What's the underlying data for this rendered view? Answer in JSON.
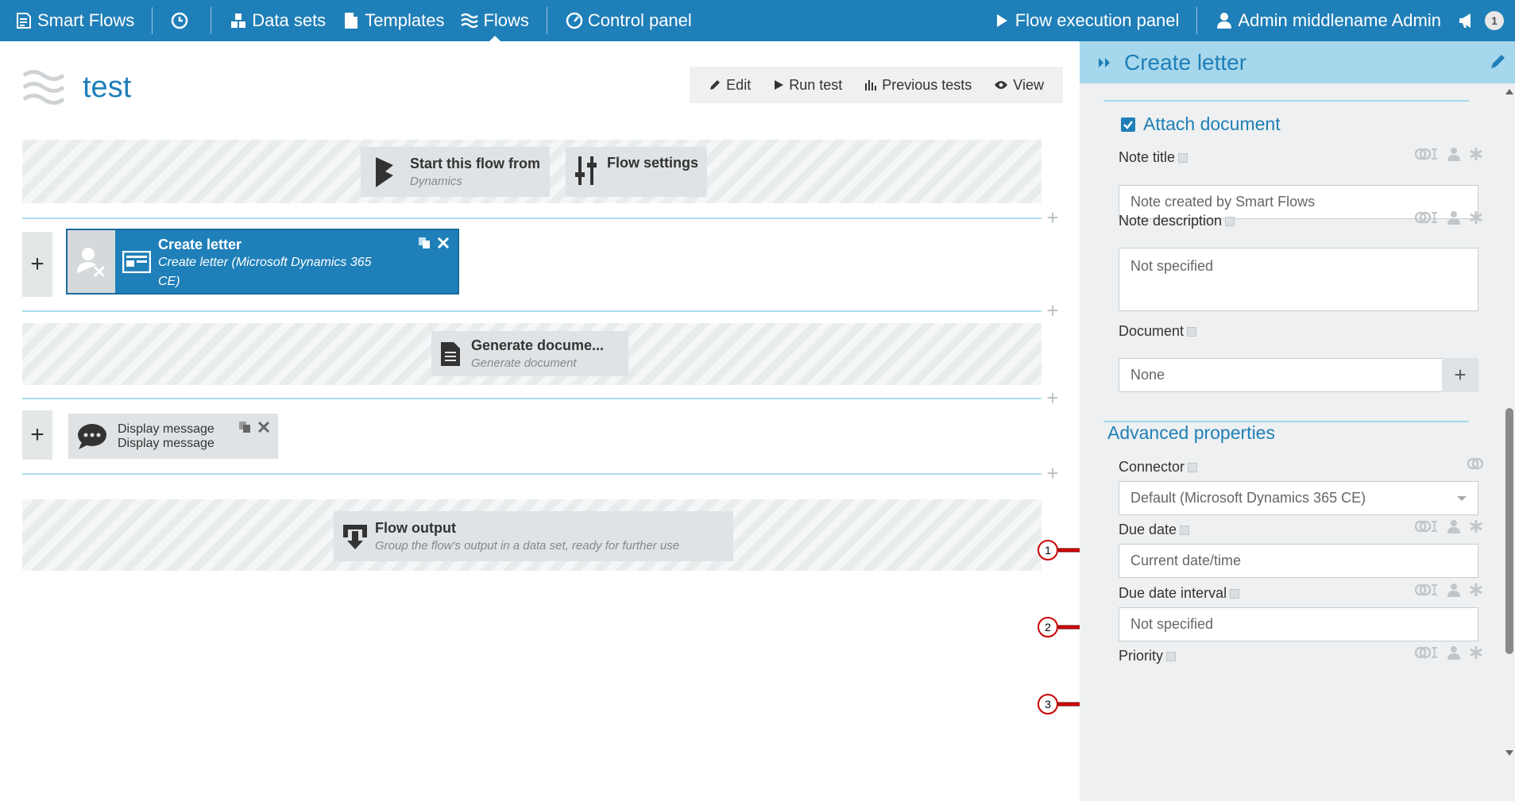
{
  "topbar": {
    "brand": "Smart Flows",
    "nav": {
      "data_sets": "Data sets",
      "templates": "Templates",
      "flows": "Flows",
      "control_panel": "Control panel",
      "flow_execution_panel": "Flow execution panel",
      "user": "Admin middlename Admin",
      "notification_count": "1"
    }
  },
  "flow": {
    "title": "test",
    "toolbar": {
      "edit": "Edit",
      "run_test": "Run test",
      "previous_tests": "Previous tests",
      "view": "View"
    }
  },
  "canvas": {
    "start": {
      "title": "Start this flow from",
      "subtitle": "Dynamics"
    },
    "settings": {
      "title": "Flow settings"
    },
    "create_letter": {
      "title": "Create letter",
      "subtitle": "Create letter (Microsoft Dynamics 365 CE)"
    },
    "generate": {
      "title": "Generate docume...",
      "subtitle": "Generate document"
    },
    "display_message": {
      "title": "Display message",
      "subtitle": "Display message"
    },
    "output": {
      "title": "Flow output",
      "subtitle": "Group the flow's output in a data set, ready for further use"
    }
  },
  "panel": {
    "title": "Create letter",
    "attach_document": "Attach document",
    "fields": {
      "note_title": {
        "label": "Note title",
        "value": "Note created by Smart Flows"
      },
      "note_description": {
        "label": "Note description",
        "value": "Not specified"
      },
      "document": {
        "label": "Document",
        "value": "None"
      },
      "connector": {
        "label": "Connector",
        "value": "Default (Microsoft Dynamics 365 CE)"
      },
      "due_date": {
        "label": "Due date",
        "value": "Current date/time"
      },
      "due_date_interval": {
        "label": "Due date interval",
        "value": "Not specified"
      },
      "priority": {
        "label": "Priority"
      }
    },
    "advanced_properties": "Advanced properties"
  },
  "annotations": [
    "1",
    "2",
    "3"
  ],
  "colors": {
    "brand": "#1f7fb8",
    "panel_header": "#a7d7ec",
    "annotation": "#e00000"
  }
}
